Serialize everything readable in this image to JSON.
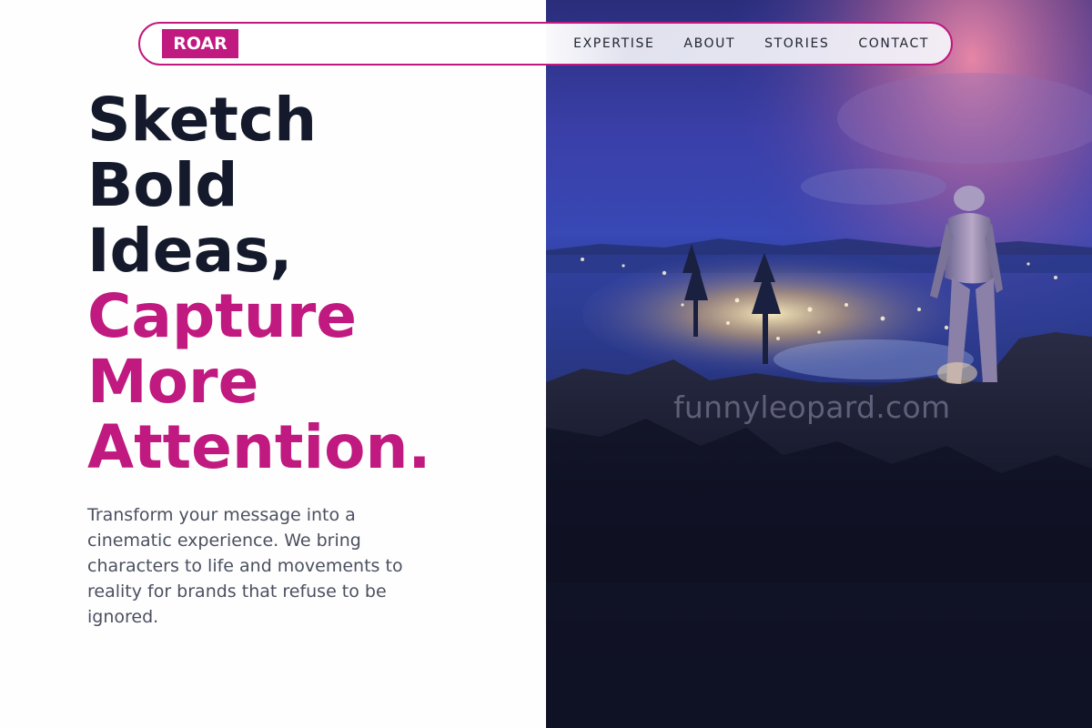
{
  "brand": {
    "logo_text": "ROAR",
    "accent_color": "#c0197f"
  },
  "nav": {
    "items": [
      {
        "label": "EXPERTISE"
      },
      {
        "label": "ABOUT"
      },
      {
        "label": "STORIES"
      },
      {
        "label": "CONTACT"
      }
    ]
  },
  "hero": {
    "headline_dark": [
      "Sketch",
      "Bold",
      "Ideas,"
    ],
    "headline_accent": [
      "Capture",
      "More",
      "Attention."
    ],
    "description": "Transform your message into a cinematic experience. We bring characters to life and movements to reality for brands that refuse to be ignored.",
    "image_alt": "Astronaut standing on a cliff overlooking a glowing city at night",
    "watermark": "funnyleopard.com"
  },
  "colors": {
    "heading": "#141a2b",
    "body_text": "#4b5060",
    "accent": "#c0197f"
  }
}
